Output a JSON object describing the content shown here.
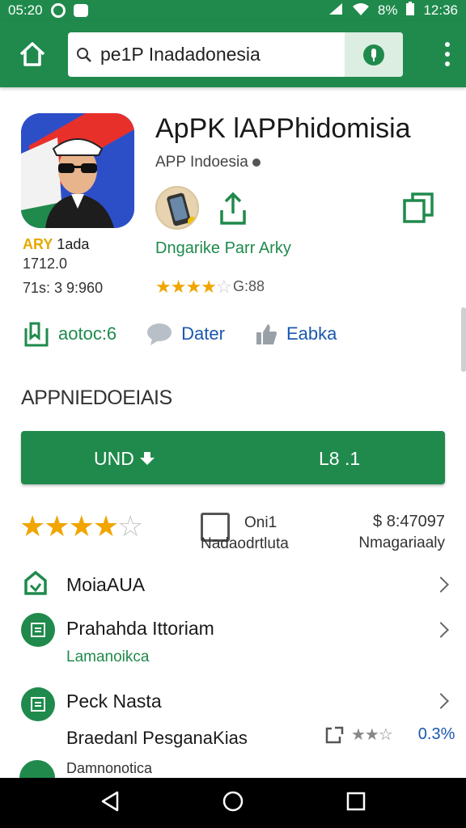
{
  "status_bar": {
    "time_left": "05:20",
    "battery": "8%",
    "time_right": "12:36"
  },
  "search": {
    "value": "pe1P Inadadonesia"
  },
  "app": {
    "title": "ApPK lAPPhidomisia",
    "developer": "APP Indoesia",
    "promo": "Dngarike Parr Arky",
    "rating_count": "G:88",
    "meta_tag": "ARY",
    "meta_line1_rest": "1ada",
    "meta_line2": "1712.0",
    "meta_line3": "71s: 3 9:960",
    "small_rating": 3.5
  },
  "actions": [
    {
      "label": "aotoc:6"
    },
    {
      "label": "Dater"
    },
    {
      "label": "Eabka"
    }
  ],
  "section_heading": "APPNIEDOEIAIS",
  "install": {
    "left_label": "UND",
    "right_label": "L8 .1"
  },
  "stats": {
    "big_rating": 3.5,
    "middle_value": "Oni1",
    "middle_label": "Nadaodrtluta",
    "right_value": "$ 8:47097",
    "right_label": "Nmagariaaly"
  },
  "list": [
    {
      "title": "MoiaAUA",
      "subtitle": "",
      "icon": "store-outline-icon"
    },
    {
      "title": "Prahahda Ittoriam",
      "subtitle": "Lamanoikca",
      "icon": "document-circle-icon"
    },
    {
      "title": "Peck Nasta",
      "subtitle": "",
      "icon": "document-circle-icon"
    }
  ],
  "extra_line": "Braedanl PesganaKias",
  "extra_percent": "0.3%",
  "partial_item": "Damnonotica",
  "colors": {
    "primary": "#1f8a4c",
    "link": "#1a58b0",
    "star": "#f0a500"
  }
}
